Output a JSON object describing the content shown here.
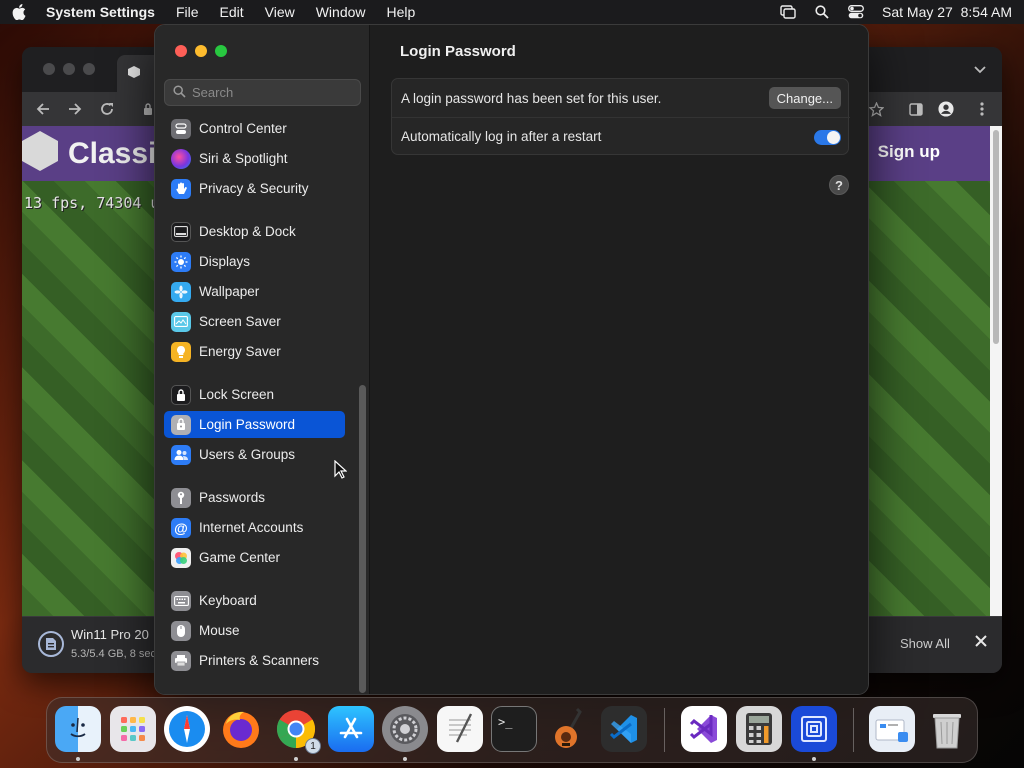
{
  "menubar": {
    "app_name": "System Settings",
    "menus": [
      "File",
      "Edit",
      "View",
      "Window",
      "Help"
    ],
    "clock": "Sat May 27  8:54 AM"
  },
  "browser": {
    "site_title": "Classi",
    "signup_label": "Sign up",
    "fps_text": "13 fps, 74304 u",
    "download": {
      "name": "Win11 Pro 20",
      "meta": "5.3/5.4 GB, 8 sec",
      "show_all": "Show All"
    }
  },
  "settings": {
    "search_placeholder": "Search",
    "sidebar": [
      {
        "label": "Control Center",
        "icon": "control-center-icon",
        "color": "#6e6e73"
      },
      {
        "label": "Siri & Spotlight",
        "icon": "siri-icon",
        "color": "#8a3bd1"
      },
      {
        "label": "Privacy & Security",
        "icon": "hand-icon",
        "color": "#2d7cf6"
      },
      {
        "label": "Desktop & Dock",
        "icon": "dock-icon",
        "color": "#1c1c1e"
      },
      {
        "label": "Displays",
        "icon": "sun-icon",
        "color": "#2d7cf6"
      },
      {
        "label": "Wallpaper",
        "icon": "flower-icon",
        "color": "#35aaf0"
      },
      {
        "label": "Screen Saver",
        "icon": "screen-saver-icon",
        "color": "#5ac8e8"
      },
      {
        "label": "Energy Saver",
        "icon": "bulb-icon",
        "color": "#f5b324"
      },
      {
        "label": "Lock Screen",
        "icon": "lock-icon",
        "color": "#1c1c1e"
      },
      {
        "label": "Login Password",
        "icon": "key-lock-icon",
        "color": "#8e8e93"
      },
      {
        "label": "Users & Groups",
        "icon": "users-icon",
        "color": "#2d7cf6"
      },
      {
        "label": "Passwords",
        "icon": "key-icon",
        "color": "#8e8e93"
      },
      {
        "label": "Internet Accounts",
        "icon": "at-icon",
        "color": "#2d7cf6"
      },
      {
        "label": "Game Center",
        "icon": "game-center-icon",
        "color": "#f0f0f0"
      },
      {
        "label": "Keyboard",
        "icon": "keyboard-icon",
        "color": "#8e8e93"
      },
      {
        "label": "Mouse",
        "icon": "mouse-icon",
        "color": "#8e8e93"
      },
      {
        "label": "Printers & Scanners",
        "icon": "printer-icon",
        "color": "#8e8e93"
      }
    ],
    "selected": "Login Password",
    "main": {
      "title": "Login Password",
      "password_row": "A login password has been set for this user.",
      "change_label": "Change...",
      "autologin_row": "Automatically log in after a restart",
      "autologin_enabled": true,
      "help": "?"
    }
  },
  "dock": {
    "apps": [
      "Finder",
      "Launchpad",
      "Safari",
      "Firefox",
      "Chrome",
      "App Store",
      "System Settings",
      "TextEdit",
      "Terminal",
      "GarageBand",
      "VS Code",
      "Visual Studio",
      "Calculator",
      "Screen Sharing",
      "Downloads",
      "Trash"
    ],
    "chrome_badge": "1"
  },
  "colors": {
    "accent": "#0a55d6",
    "toggle_on": "#2a78e8"
  }
}
